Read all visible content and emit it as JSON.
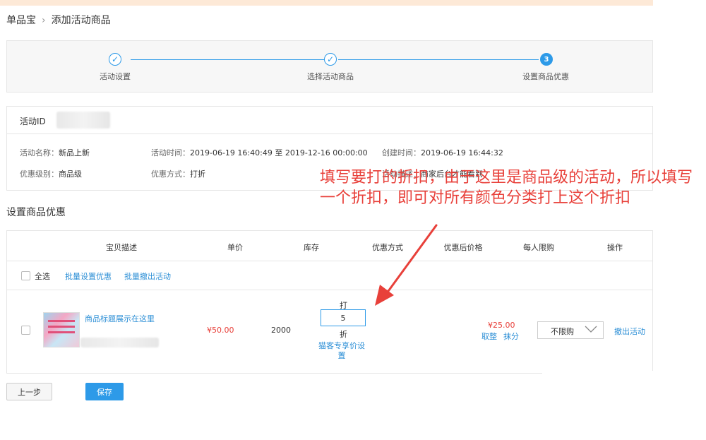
{
  "breadcrumb": {
    "root": "单品宝",
    "separator": "›",
    "current": "添加活动商品"
  },
  "steps": [
    {
      "label": "活动设置",
      "state": "done",
      "mark": "✓"
    },
    {
      "label": "选择活动商品",
      "state": "done",
      "mark": "✓"
    },
    {
      "label": "设置商品优惠",
      "state": "active",
      "mark": "3"
    }
  ],
  "activity": {
    "id_label": "活动ID",
    "name_label": "活动名称：",
    "name": "新品上新",
    "time_label": "活动时间：",
    "time": "2019-06-19 16:40:49 至 2019-12-16 00:00:00",
    "created_label": "创建时间：",
    "created": "2019-06-19 16:44:32",
    "level_label": "优惠级别：",
    "level": "商品级",
    "method_label": "优惠方式：",
    "method": "打折",
    "desc_label": "活动描述：",
    "desc": "商家后台才能看到"
  },
  "section_title": "设置商品优惠",
  "table": {
    "headers": [
      "宝贝描述",
      "单价",
      "库存",
      "优惠方式",
      "优惠后价格",
      "每人限购",
      "操作"
    ],
    "select_all": "全选",
    "batch_set": "批量设置优惠",
    "batch_cancel": "批量撤出活动",
    "rows": [
      {
        "title": "商品标题展示在这里",
        "price": "¥50.00",
        "stock": "2000",
        "discount_prefix": "打",
        "discount_value": "5",
        "discount_suffix": "折",
        "vip_link": "猫客专享价设置",
        "final_price": "¥25.00",
        "round_whole": "取整",
        "round_cents": "抹分",
        "limit": "不限购",
        "action": "撤出活动"
      }
    ]
  },
  "buttons": {
    "prev": "上一步",
    "save": "保存"
  },
  "annotation": {
    "text": "填写要打的折扣，由于这里是商品级的活动，所以填写一个折扣，即可对所有颜色分类打上这个折扣",
    "color": "#e8403a"
  },
  "colors": {
    "accent": "#2d9ae8",
    "price": "#e8403a",
    "link": "#2d8fd6"
  }
}
